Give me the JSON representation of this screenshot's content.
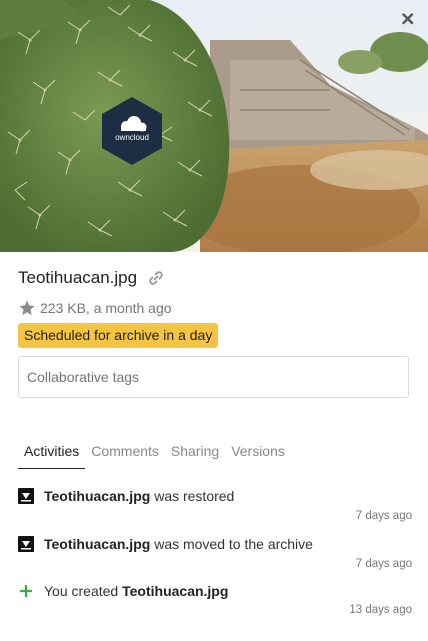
{
  "preview": {
    "image": "cactus-with-owncloud-sticker-photo",
    "sticker_text": "owncloud"
  },
  "close": {
    "icon": "close-icon"
  },
  "file": {
    "name": "Teotihuacan.jpg",
    "meta": "223 KB, a month ago",
    "archive_badge": "Scheduled for archive in a day",
    "badge_color": "#f6c443"
  },
  "tags": {
    "placeholder": "Collaborative tags"
  },
  "tabs": [
    {
      "label": "Activities",
      "active": true
    },
    {
      "label": "Comments",
      "active": false
    },
    {
      "label": "Sharing",
      "active": false
    },
    {
      "label": "Versions",
      "active": false
    }
  ],
  "activities": [
    {
      "icon": "archive-restore-icon",
      "filename": "Teotihuacan.jpg",
      "text": " was restored",
      "prefix": "",
      "date": "7 days ago"
    },
    {
      "icon": "archive-move-icon",
      "filename": "Teotihuacan.jpg",
      "text": " was moved to the archive",
      "prefix": "",
      "date": "7 days ago"
    },
    {
      "icon": "plus-icon",
      "filename": "Teotihuacan.jpg",
      "text": "",
      "prefix": "You created ",
      "date": "13 days ago"
    }
  ]
}
